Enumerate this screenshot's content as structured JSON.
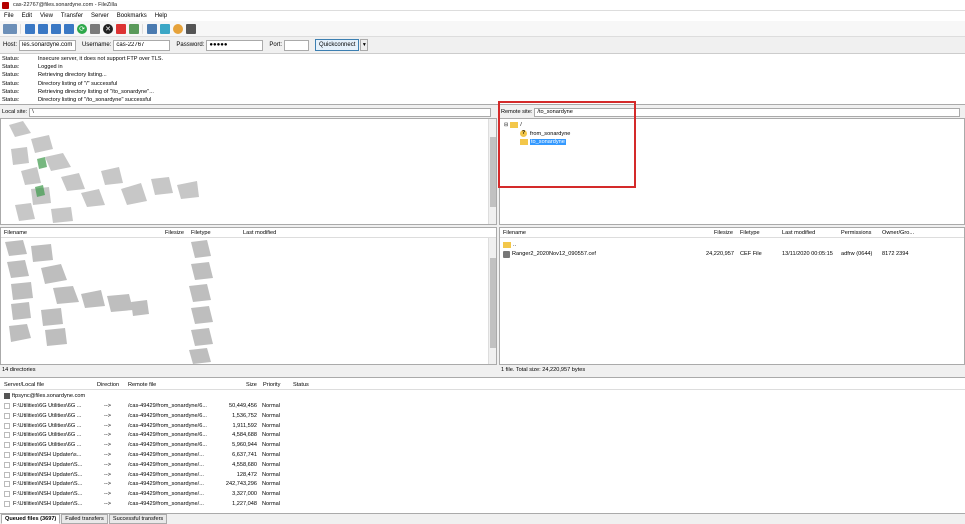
{
  "window": {
    "title": "cas-22767@files.sonardyne.com - FileZilla"
  },
  "menu": [
    "File",
    "Edit",
    "View",
    "Transfer",
    "Server",
    "Bookmarks",
    "Help"
  ],
  "quickconnect": {
    "host_label": "Host:",
    "host_value": "les.sonardyne.com",
    "username_label": "Username:",
    "username_value": "cas-22767",
    "password_label": "Password:",
    "password_value": "●●●●●",
    "port_label": "Port:",
    "port_value": "",
    "button_label": "Quickconnect",
    "dropdown_glyph": "▼"
  },
  "log": [
    {
      "k": "Status:",
      "v": "Insecure server, it does not support FTP over TLS."
    },
    {
      "k": "Status:",
      "v": "Logged in"
    },
    {
      "k": "Status:",
      "v": "Retrieving directory listing..."
    },
    {
      "k": "Status:",
      "v": "Directory listing of \"/\" successful"
    },
    {
      "k": "Status:",
      "v": "Retrieving directory listing of \"/to_sonardyne\"..."
    },
    {
      "k": "Status:",
      "v": "Directory listing of \"/to_sonardyne\" successful"
    }
  ],
  "local": {
    "site_label": "Local site:",
    "site_value": "\\",
    "columns": [
      "Filename",
      "Filesize",
      "Filetype",
      "Last modified"
    ],
    "status": "14 directories"
  },
  "remote": {
    "site_label": "Remote site:",
    "site_value": "/to_sonardyne",
    "tree_root": "/",
    "tree_items": [
      "from_sonardyne",
      "to_sonardyne"
    ],
    "columns": [
      "Filename",
      "Filesize",
      "Filetype",
      "Last modified",
      "Permissions",
      "Owner/Gro..."
    ],
    "parent_dir": "..",
    "files": [
      {
        "name": "Ranger2_2020Nov12_090557.cef",
        "size": "24,220,957",
        "type": "CEF File",
        "modified": "13/11/2020 00:05:15",
        "perms": "adfrw (0644)",
        "owner": "8172 2394"
      }
    ],
    "status": "1 file. Total size: 24,220,957 bytes"
  },
  "queue": {
    "columns": [
      "Server/Local file",
      "Direction",
      "Remote file",
      "Size",
      "Priority",
      "Status"
    ],
    "server": "ftpsync@files.sonardyne.com",
    "rows": [
      {
        "local": "F:\\Utilities\\6G Utilities\\6G ...",
        "dir": "-->",
        "remote": "/cas-49429/from_sonardyne/6...",
        "size": "50,449,456",
        "prio": "Normal"
      },
      {
        "local": "F:\\Utilities\\6G Utilities\\6G ...",
        "dir": "-->",
        "remote": "/cas-49429/from_sonardyne/6...",
        "size": "1,536,752",
        "prio": "Normal"
      },
      {
        "local": "F:\\Utilities\\6G Utilities\\6G ...",
        "dir": "-->",
        "remote": "/cas-49429/from_sonardyne/6...",
        "size": "1,911,592",
        "prio": "Normal"
      },
      {
        "local": "F:\\Utilities\\6G Utilities\\6G ...",
        "dir": "-->",
        "remote": "/cas-49429/from_sonardyne/6...",
        "size": "4,584,688",
        "prio": "Normal"
      },
      {
        "local": "F:\\Utilities\\6G Utilities\\6G ...",
        "dir": "-->",
        "remote": "/cas-49429/from_sonardyne/6...",
        "size": "5,960,944",
        "prio": "Normal"
      },
      {
        "local": "F:\\Utilities\\NSH Updater\\s...",
        "dir": "-->",
        "remote": "/cas-49429/from_sonardyne/...",
        "size": "6,637,741",
        "prio": "Normal"
      },
      {
        "local": "F:\\Utilities\\NSH Updater\\S...",
        "dir": "-->",
        "remote": "/cas-49429/from_sonardyne/...",
        "size": "4,558,680",
        "prio": "Normal"
      },
      {
        "local": "F:\\Utilities\\NSH Updater\\S...",
        "dir": "-->",
        "remote": "/cas-49429/from_sonardyne/...",
        "size": "128,472",
        "prio": "Normal"
      },
      {
        "local": "F:\\Utilities\\NSH Updater\\S...",
        "dir": "-->",
        "remote": "/cas-49429/from_sonardyne/...",
        "size": "242,743,296",
        "prio": "Normal"
      },
      {
        "local": "F:\\Utilities\\NSH Updater\\S...",
        "dir": "-->",
        "remote": "/cas-49429/from_sonardyne/...",
        "size": "3,327,000",
        "prio": "Normal"
      },
      {
        "local": "F:\\Utilities\\NSH Updater\\S...",
        "dir": "-->",
        "remote": "/cas-49429/from_sonardyne/...",
        "size": "1,227,048",
        "prio": "Normal"
      }
    ]
  },
  "tabs": [
    {
      "label": "Queued files (3697)",
      "active": true
    },
    {
      "label": "Failed transfers",
      "active": false
    },
    {
      "label": "Successful transfers",
      "active": false
    }
  ],
  "colors": {
    "highlight": "#d42a2a",
    "selection": "#3399ff",
    "folder": "#f3c74a"
  }
}
